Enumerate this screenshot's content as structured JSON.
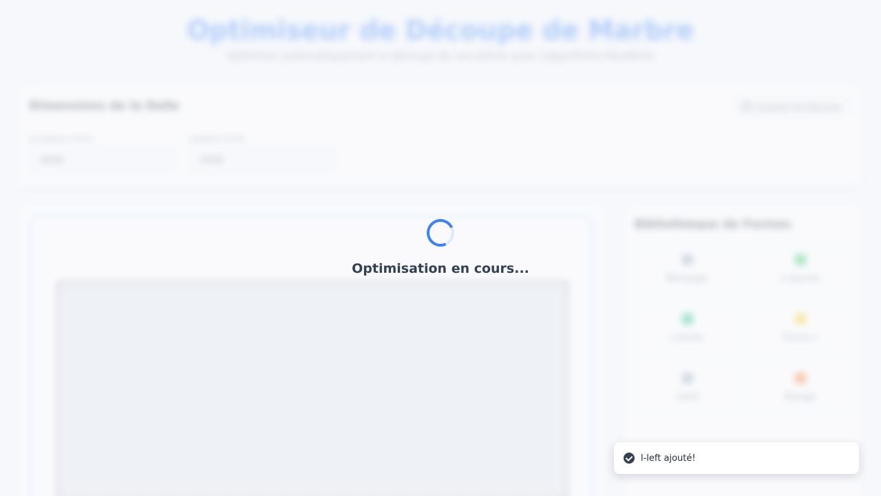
{
  "header": {
    "title": "Optimiseur de Découpe de Marbre",
    "subtitle": "Optimisez automatiquement la découpe de vos pièces avec l'algorithme MaxRects"
  },
  "dimensions": {
    "title": "Dimensions de la Dalle",
    "export_label": "Exporter les Mesures",
    "length_label": "Longueur (mm)",
    "length_value": "3000",
    "width_label": "Largeur (mm)",
    "width_value": "1400"
  },
  "library": {
    "title": "Bibliothèque de Formes",
    "shapes": [
      {
        "name": "Rectangle",
        "color": "#94a3b8"
      },
      {
        "name": "L-Gauche",
        "color": "#22c55e"
      },
      {
        "name": "L-Droite",
        "color": "#10b981"
      },
      {
        "name": "Forme U",
        "color": "#facc15"
      },
      {
        "name": "Carré",
        "color": "#94a3b8"
      },
      {
        "name": "Triangle",
        "color": "#f97316"
      }
    ]
  },
  "loading": {
    "text": "Optimisation en cours..."
  },
  "toast": {
    "message": "l-left ajouté!"
  },
  "colors": {
    "accent": "#3b82f6",
    "toast_icon": "#334155"
  }
}
